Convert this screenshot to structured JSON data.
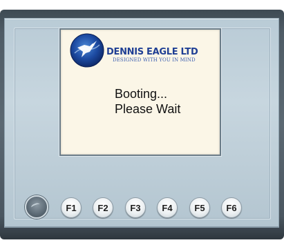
{
  "brand": {
    "name": "DENNIS EAGLE LTD",
    "tagline": "DESIGNED WITH YOU IN MIND",
    "logo_icon": "eagle-globe-logo"
  },
  "status": {
    "line1": "Booting...",
    "line2": "Please Wait"
  },
  "controls": {
    "knob_icon": "rotary-knob-icon",
    "function_keys": [
      "F1",
      "F2",
      "F3",
      "F4",
      "F5",
      "F6"
    ]
  },
  "colors": {
    "brand_blue": "#1f3f94",
    "screen_background": "#fbf6e7",
    "bezel": "#c7d6df"
  }
}
